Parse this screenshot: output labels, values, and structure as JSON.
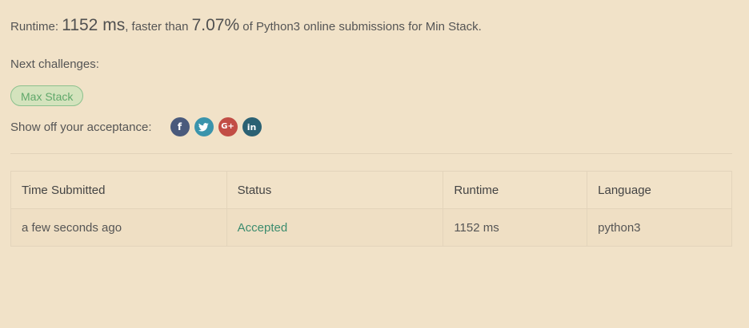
{
  "summary": {
    "runtime_prefix": "Runtime: ",
    "runtime_value": "1152 ms",
    "faster_than_text": ", faster than ",
    "percentile": "7.07%",
    "suffix": " of Python3 online submissions for Min Stack."
  },
  "next_challenges": {
    "label": "Next challenges:",
    "items": [
      {
        "label": "Max Stack"
      }
    ]
  },
  "share": {
    "label": "Show off your acceptance:",
    "icons": [
      {
        "name": "facebook-icon",
        "glyph": "f",
        "color": "#4a5a7c"
      },
      {
        "name": "twitter-icon",
        "glyph": "",
        "color": "#3a94ac"
      },
      {
        "name": "google-plus-icon",
        "glyph": "G+",
        "color": "#c24d45"
      },
      {
        "name": "linkedin-icon",
        "glyph": "in",
        "color": "#2b6173"
      }
    ]
  },
  "table": {
    "headers": [
      "Time Submitted",
      "Status",
      "Runtime",
      "Language"
    ],
    "rows": [
      {
        "time": "a few seconds ago",
        "status": "Accepted",
        "runtime": "1152 ms",
        "language": "python3"
      }
    ],
    "status_color": "#3c8c6e"
  }
}
